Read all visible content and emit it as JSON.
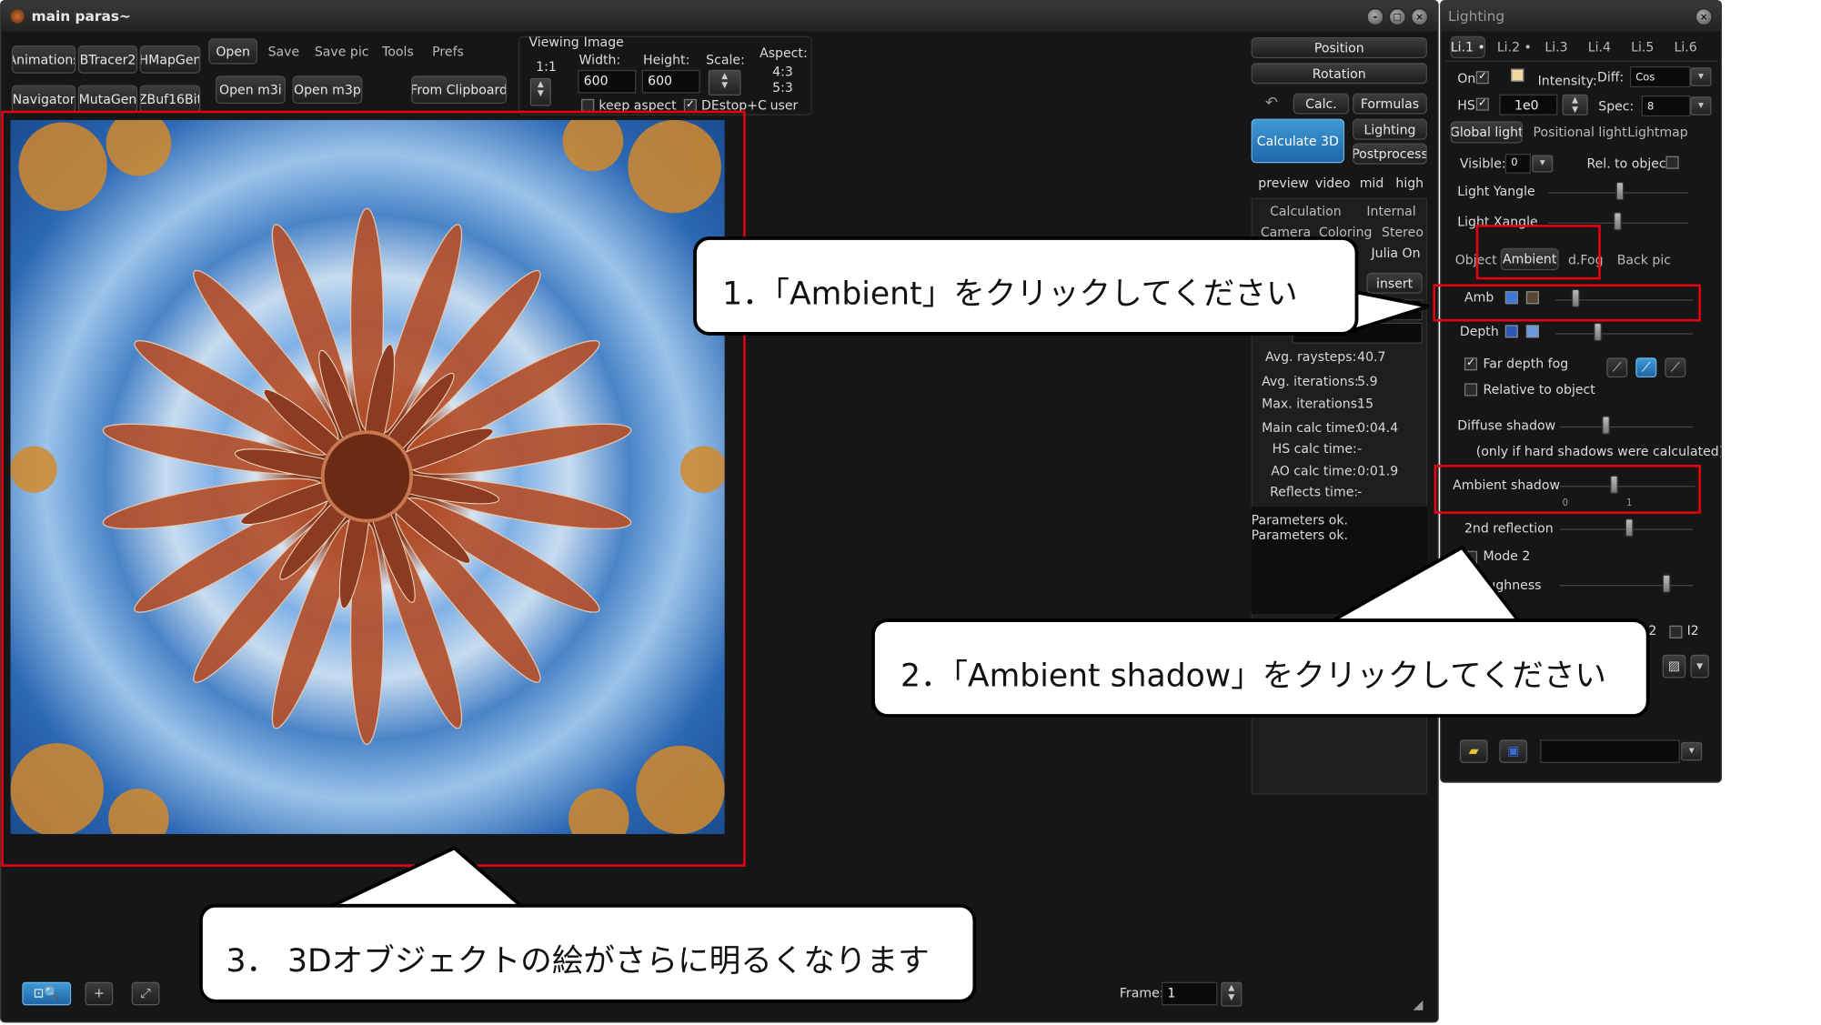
{
  "main_window": {
    "title": "main paras~",
    "toolbar_left": [
      "Animations",
      "BTracer2",
      "HMapGen",
      "Navigator",
      "MutaGen",
      "ZBuf16Bit"
    ],
    "menu": [
      "Open",
      "Save",
      "Save pic",
      "Tools",
      "Prefs"
    ],
    "open_m3i": "Open m3i",
    "open_m3p": "Open m3p",
    "from_clipboard": "From Clipboard",
    "viewing_label": "Viewing",
    "viewing_value": "1:1",
    "image_label": "Image",
    "width_label": "Width:",
    "width_value": "600",
    "height_label": "Height:",
    "height_value": "600",
    "scale_label": "Scale:",
    "aspect_label": "Aspect:",
    "aspect_values": [
      "4:3",
      "5:3",
      "user"
    ],
    "keep_aspect": "keep aspect",
    "destop": "DEstop+C",
    "right_panel": {
      "position": "Position",
      "rotation": "Rotation",
      "calc": "Calc.",
      "formulas": "Formulas",
      "lighting": "Lighting",
      "calculate_3d": "Calculate 3D",
      "postprocess": "Postprocess",
      "quality": [
        "preview",
        "video",
        "mid",
        "high"
      ],
      "tabs_row1": [
        "Calculation",
        "Internal"
      ],
      "tabs_row2": [
        "Camera",
        "Coloring",
        "Stereo"
      ],
      "julia_on": "Julia On",
      "insert": "insert",
      "stats": [
        {
          "label": "Avg. raysteps:",
          "value": "40.7"
        },
        {
          "label": "Avg. iterations:",
          "value": "5.9"
        },
        {
          "label": "Max. iterations:",
          "value": "15"
        },
        {
          "label": "Main calc time:",
          "value": "0:04.4"
        },
        {
          "label": "HS calc time:",
          "value": "-"
        },
        {
          "label": "AO calc time:",
          "value": "0:01.9"
        },
        {
          "label": "Reflects time:",
          "value": "-"
        }
      ],
      "log": [
        "Parameters ok.",
        "Parameters ok."
      ]
    },
    "frame_label": "Frame:",
    "frame_value": "1"
  },
  "lighting_window": {
    "title": "Lighting",
    "light_tabs": [
      "Li.1 •",
      "Li.2 •",
      "Li.3",
      "Li.4",
      "Li.5",
      "Li.6"
    ],
    "on_label": "On",
    "intensity_label": "Intensity:",
    "diff_label": "Diff:",
    "diff_value": "Cos",
    "hs_label": "HS",
    "hs_value": "1e0",
    "spec_label": "Spec:",
    "spec_value": "8",
    "light_type_tabs": [
      "Global light",
      "Positional light",
      "Lightmap"
    ],
    "visible_label": "Visible:",
    "visible_value": "0",
    "rel_to_object": "Rel. to object:",
    "light_yangle": "Light Yangle",
    "light_xangle": "Light Xangle",
    "sub_tabs": [
      "Object",
      "Ambient",
      "d.Fog",
      "Back pic"
    ],
    "amb_label": "Amb",
    "depth_label": "Depth",
    "far_depth_fog": "Far depth fog",
    "relative_to_object": "Relative to object",
    "diffuse_shadow": "Diffuse shadow",
    "diffuse_note": "(only if hard shadows were calculated)",
    "ambient_shadow": "Ambient shadow",
    "ambient_ticks": [
      "0",
      "1"
    ],
    "second_reflection": "2nd reflection",
    "mode2": "Mode 2",
    "roughness": "Roughness",
    "i2_label": "I2",
    "i_label": "2"
  },
  "callouts": {
    "c1": "1．「Ambient」をクリックしてください",
    "c2": "2．「Ambient shadow」をクリックしてください",
    "c3": "3．  3Dオブジェクトの絵がさらに明るくなります"
  },
  "colors": {
    "highlight_red": "#e60012",
    "button_blue": "#2f80c4",
    "amb_swatch_1": "#3c78d8",
    "amb_swatch_2": "#5a4630",
    "depth_swatch_1": "#2c58b8",
    "depth_swatch_2": "#6a9ae0",
    "light_color": "#f5d9a0"
  }
}
